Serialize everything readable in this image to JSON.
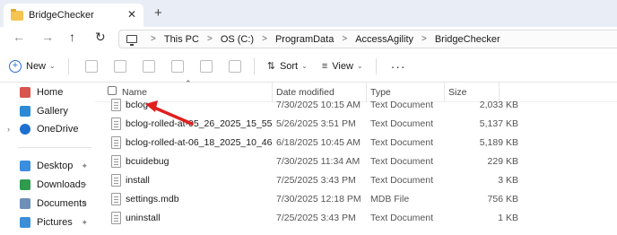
{
  "window": {
    "tab_title": "BridgeChecker",
    "tab_close": "✕",
    "tab_add": "+"
  },
  "address": {
    "back": "←",
    "forward": "→",
    "up": "↑",
    "refresh": "↻",
    "crumbs": [
      "This PC",
      "OS (C:)",
      "ProgramData",
      "AccessAgility",
      "BridgeChecker"
    ],
    "separator": ">"
  },
  "toolbar": {
    "new_label": "New",
    "sort_label": "Sort",
    "view_label": "View",
    "more_label": "···"
  },
  "sidebar": {
    "items": [
      {
        "label": "Home",
        "icon": "home-icon",
        "color": "#d9534f"
      },
      {
        "label": "Gallery",
        "icon": "gallery-icon",
        "color": "#2a8ad6"
      },
      {
        "label": "OneDrive",
        "icon": "cloud-icon",
        "color": "#1f6fd1"
      },
      {
        "label": "Desktop",
        "icon": "desktop-icon",
        "color": "#3b8de0"
      },
      {
        "label": "Downloads",
        "icon": "download-icon",
        "color": "#2e9b4f"
      },
      {
        "label": "Documents",
        "icon": "documents-icon",
        "color": "#6d8fb8"
      },
      {
        "label": "Pictures",
        "icon": "pictures-icon",
        "color": "#3a8fd8"
      }
    ]
  },
  "columns": {
    "name": "Name",
    "date": "Date modified",
    "type": "Type",
    "size": "Size"
  },
  "files": [
    {
      "name": "bclog",
      "date": "7/30/2025 10:15 AM",
      "type": "Text Document",
      "size": "2,033 KB"
    },
    {
      "name": "bclog-rolled-at-05_26_2025_15_55",
      "date": "5/26/2025 3:51 PM",
      "type": "Text Document",
      "size": "5,137 KB"
    },
    {
      "name": "bclog-rolled-at-06_18_2025_10_46",
      "date": "6/18/2025 10:45 AM",
      "type": "Text Document",
      "size": "5,189 KB"
    },
    {
      "name": "bcuidebug",
      "date": "7/30/2025 11:34 AM",
      "type": "Text Document",
      "size": "229 KB"
    },
    {
      "name": "install",
      "date": "7/25/2025 3:43 PM",
      "type": "Text Document",
      "size": "3 KB"
    },
    {
      "name": "settings.mdb",
      "date": "7/30/2025 12:18 PM",
      "type": "MDB File",
      "size": "756 KB"
    },
    {
      "name": "uninstall",
      "date": "7/25/2025 3:43 PM",
      "type": "Text Document",
      "size": "1 KB"
    }
  ],
  "annotation": {
    "color": "#e0201f"
  }
}
